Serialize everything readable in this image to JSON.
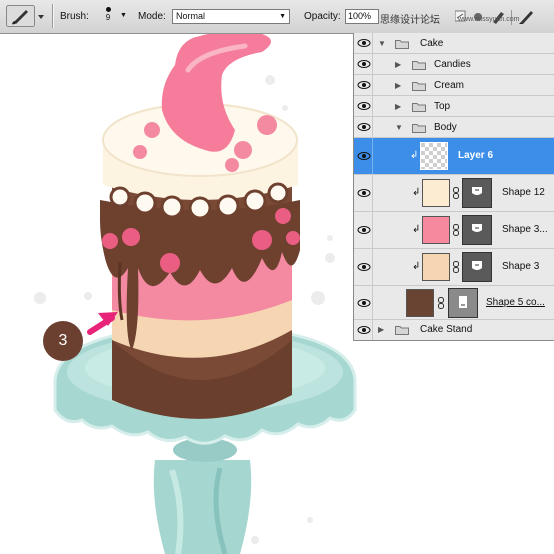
{
  "options_bar": {
    "brush_label": "Brush:",
    "brush_size": "9",
    "mode_label": "Mode:",
    "mode_value": "Normal",
    "opacity_label": "Opacity:",
    "opacity_value": "100%",
    "watermark": "思缘设计论坛"
  },
  "layers_panel": {
    "groups": {
      "cake": "Cake",
      "candies": "Candies",
      "cream": "Cream",
      "top": "Top",
      "body": "Body",
      "cake_stand": "Cake Stand"
    },
    "layers": {
      "layer6": "Layer 6",
      "shape12": "Shape 12",
      "shape3a": "Shape 3...",
      "shape3": "Shape 3",
      "shape5": "Shape 5 co..."
    },
    "swatches": {
      "shape12": "#fbecd2",
      "shape3a": "#f7899f",
      "shape3": "#f6d6b2",
      "shape5": "#6a4432"
    },
    "selected_color": "#3d8ee8"
  },
  "canvas": {
    "step_number": "3"
  },
  "watermark_corner": "www.missyuan.com"
}
